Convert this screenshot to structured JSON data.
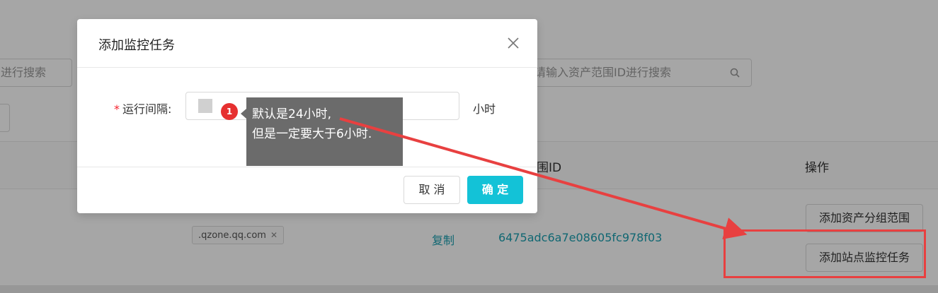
{
  "background": {
    "search_left_placeholder": "进行搜索",
    "search_right_placeholder": "请输入资产范围ID进行搜索",
    "table_headers": {
      "range_id_partial": "围ID",
      "actions": "操作"
    },
    "row": {
      "domain_tag": ".qzone.qq.com",
      "copy_link": "复制",
      "range_id": "6475adc6a7e08605fc978f03",
      "actions": [
        "添加资产分组范围",
        "添加站点监控任务"
      ]
    }
  },
  "modal": {
    "title": "添加监控任务",
    "field_label": "运行间隔:",
    "field_required_mark": "*",
    "field_value": "",
    "unit": "小时",
    "cancel_label": "取 消",
    "ok_label": "确 定"
  },
  "annotation": {
    "badge": "1",
    "tip_line1": "默认是24小时,",
    "tip_line2": "但是一定要大于6小时.",
    "accent_color": "#e84040"
  },
  "colors": {
    "primary": "#13c2d7",
    "link": "#1a9fb0",
    "danger": "#f5222d"
  }
}
